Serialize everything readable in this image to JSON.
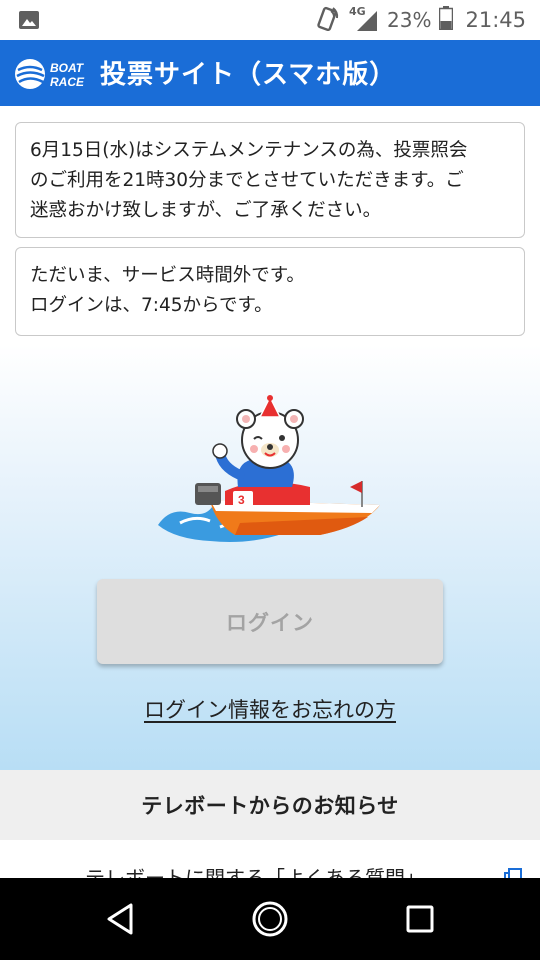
{
  "status_bar": {
    "network": "4G",
    "battery": "23%",
    "time": "21:45",
    "icons": [
      "image-icon",
      "nfc-icon",
      "signal-icon",
      "battery-icon"
    ]
  },
  "header": {
    "logo_line1": "BOAT",
    "logo_line2": "RACE",
    "title": "投票サイト（スマホ版）",
    "color": "#1a6dd7"
  },
  "notices": [
    {
      "text": "6月15日(水)はシステムメンテナンスの為、投票照会\nのご利用を21時30分までとさせていただきます。ご\n迷惑おかけ致しますが、ご了承ください。"
    },
    {
      "text": "ただいま、サービス時間外です。\nログインは、7:45からです。"
    }
  ],
  "mascot": {
    "boat_number": "3"
  },
  "login": {
    "button_label": "ログイン",
    "forgot_link": "ログイン情報をお忘れの方"
  },
  "info": {
    "header": "テレボートからのお知らせ",
    "faq_text": "テレボートに関する「よくある質問」"
  },
  "nav": {
    "icons": [
      "back-icon",
      "home-icon",
      "recent-apps-icon"
    ]
  }
}
